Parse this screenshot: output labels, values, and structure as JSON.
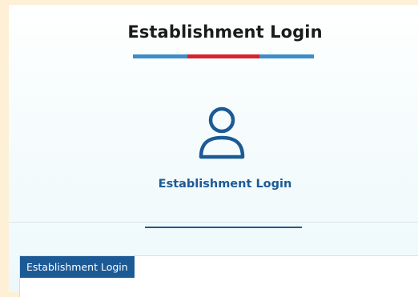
{
  "header": {
    "title": "Establishment Login"
  },
  "login_card": {
    "icon": "user-icon",
    "label": "Establishment Login"
  },
  "panel": {
    "tab_label": "Establishment Login"
  },
  "colors": {
    "accent_blue": "#1c5a96",
    "bar_blue": "#3b8ec6",
    "bar_red": "#d6232c"
  }
}
